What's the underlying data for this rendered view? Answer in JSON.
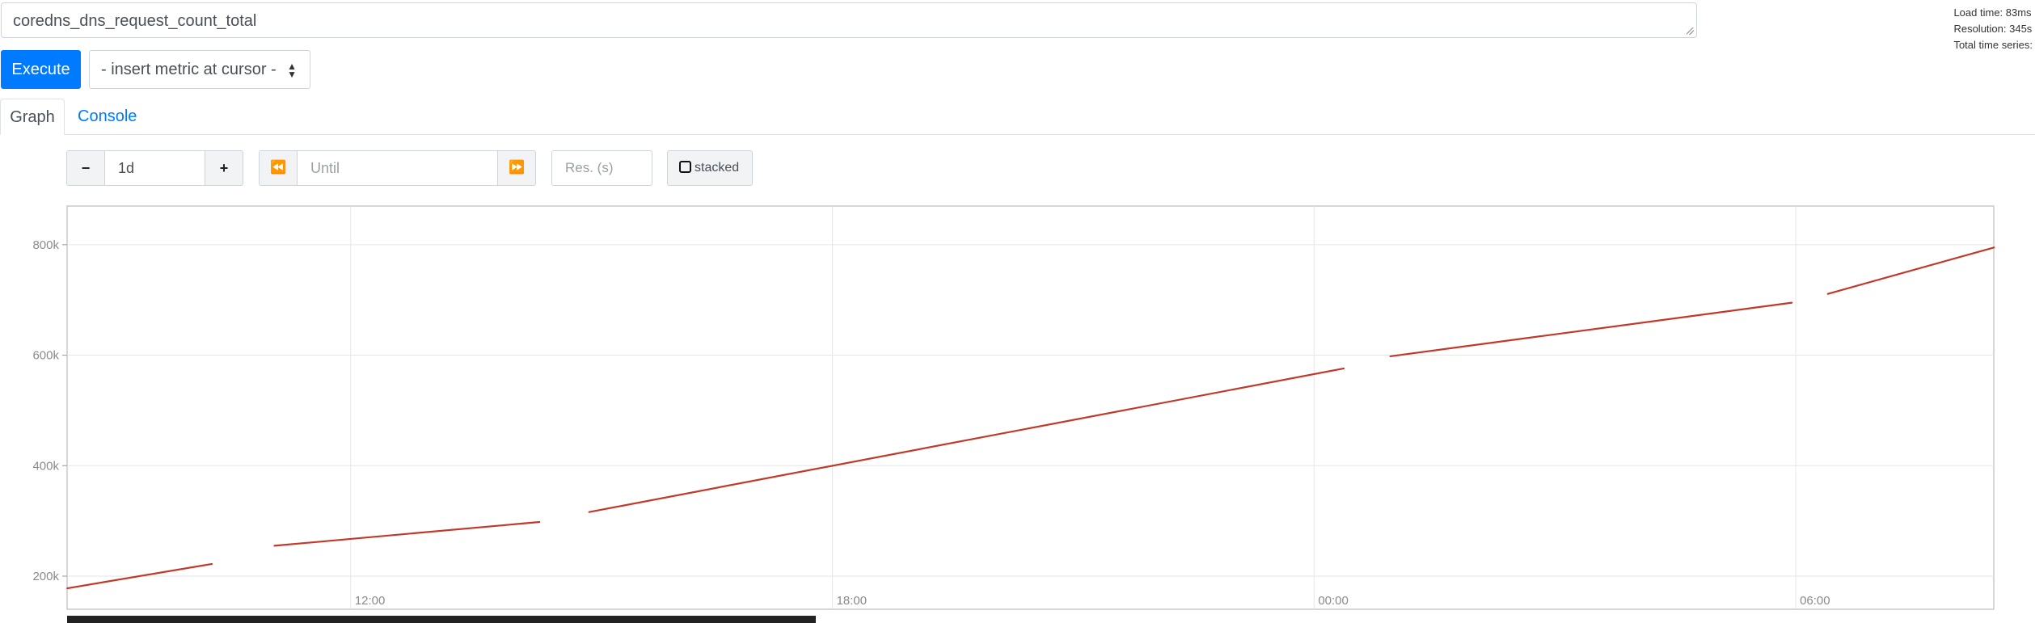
{
  "query": {
    "expression": "coredns_dns_request_count_total"
  },
  "stats": {
    "load_time": "Load time: 83ms",
    "resolution": "Resolution: 345s",
    "total_series": "Total time series:"
  },
  "toolbar": {
    "execute_label": "Execute",
    "metric_select": "- insert metric at cursor -"
  },
  "tabs": [
    {
      "label": "Graph",
      "active": true
    },
    {
      "label": "Console",
      "active": false
    }
  ],
  "graph_controls": {
    "minus": "−",
    "range": "1d",
    "plus": "+",
    "back": "⏪",
    "until_placeholder": "Until",
    "forward": "⏩",
    "res_placeholder": "Res. (s)",
    "stacked_label": "stacked"
  },
  "colors": {
    "accent": "#007bff",
    "series": "#c0392b"
  },
  "chart_data": {
    "type": "line",
    "x_axis": {
      "ticks": [
        "12:00",
        "18:00",
        "00:00",
        "06:00"
      ],
      "range": [
        "08:28",
        "08:28 (+1d)"
      ]
    },
    "y_axis": {
      "ticks": [
        "200k",
        "400k",
        "600k",
        "800k"
      ],
      "ylim": [
        140000,
        870000
      ]
    },
    "grid": true,
    "series": [
      {
        "color": "#c0392b",
        "segments": [
          {
            "x": [
              8.47,
              10.27
            ],
            "y": [
              178000,
              222000
            ]
          },
          {
            "x": [
              11.05,
              14.35
            ],
            "y": [
              255000,
              298000
            ]
          },
          {
            "x": [
              14.97,
              24.37
            ],
            "y": [
              316000,
              576000
            ]
          },
          {
            "x": [
              24.95,
              29.95
            ],
            "y": [
              598000,
              695000
            ]
          },
          {
            "x": [
              30.4,
              32.47
            ],
            "y": [
              711000,
              795000
            ]
          }
        ]
      }
    ]
  }
}
